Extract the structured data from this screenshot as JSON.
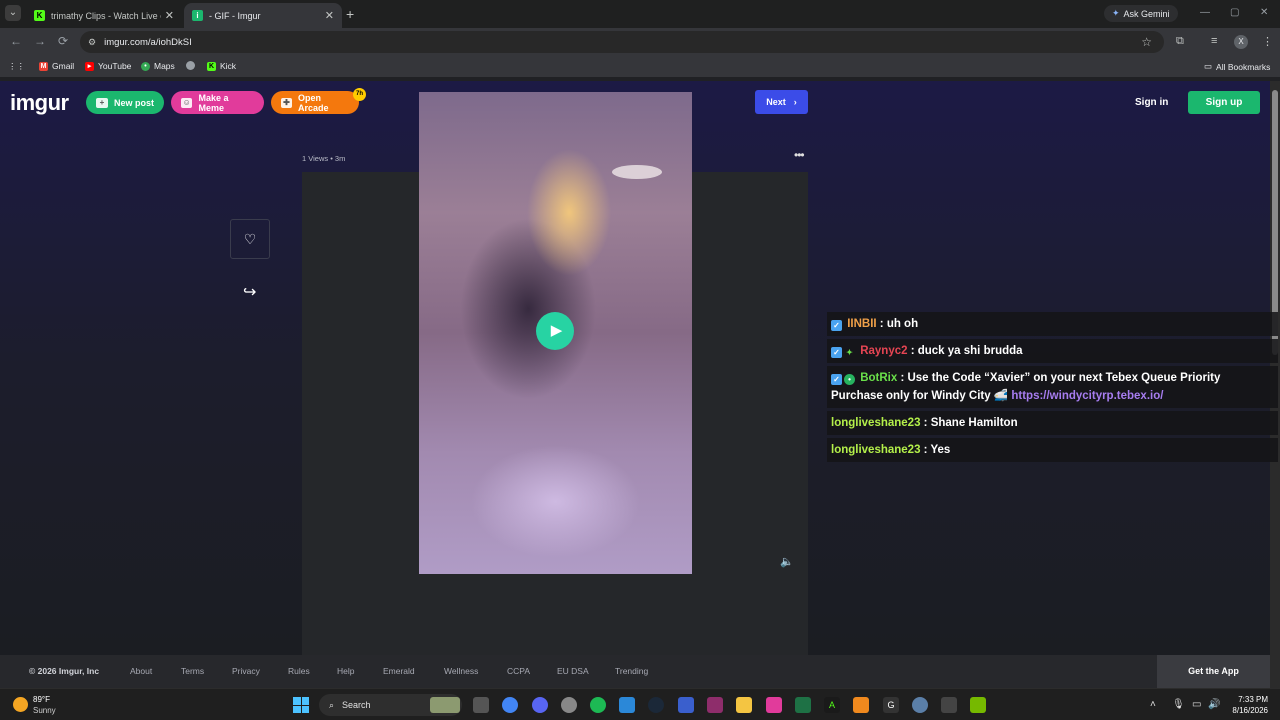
{
  "browser": {
    "tabs": [
      {
        "label": "trimathy Clips - Watch Live on Kick",
        "icon": "kick-icon"
      },
      {
        "label": "- GIF - Imgur",
        "icon": "imgur-icon"
      }
    ],
    "new_tab": "+",
    "ask_gemini": "Ask Gemini",
    "url": "imgur.com/a/iohDkSI",
    "profile_initial": "X",
    "bookmarks": [
      {
        "label": "Gmail",
        "icon": "gmail-icon"
      },
      {
        "label": "YouTube",
        "icon": "youtube-icon"
      },
      {
        "label": "Maps",
        "icon": "maps-icon"
      },
      {
        "label": "",
        "icon": "globe-icon"
      },
      {
        "label": "Kick",
        "icon": "kick-icon"
      }
    ],
    "all_bookmarks": "All Bookmarks"
  },
  "imgur": {
    "logo": "imgur",
    "new_post": "New post",
    "make_meme": "Make a Meme",
    "open_arcade": "Open Arcade",
    "arcade_badge": "7h",
    "next": "Next",
    "sign_in": "Sign in",
    "sign_up": "Sign up",
    "post_meta": "1 Views • 3m",
    "more": "•••"
  },
  "chat": [
    {
      "user": "IINBII",
      "message": " : uh oh",
      "badges": [
        "verified-icon"
      ]
    },
    {
      "user": "Raynyc2",
      "message": " : duck ya shi brudda",
      "badges": [
        "verified-icon",
        "sparkle-icon"
      ]
    },
    {
      "user": "BotRix",
      "message": " : Use the Code “Xavier” on your next Tebex Queue Priority Purchase only for Windy City 🚅 ",
      "link": "https://windycityrp.tebex.io/",
      "badges": [
        "verified-icon",
        "bot-icon"
      ]
    },
    {
      "user": "longliveshane23",
      "message": " : Shane Hamilton",
      "badges": []
    },
    {
      "user": "longliveshane23",
      "message": " : Yes",
      "badges": []
    }
  ],
  "footer": {
    "copyright": "© 2026 Imgur, Inc",
    "links": [
      "About",
      "Terms",
      "Privacy",
      "Rules",
      "Help",
      "Emerald",
      "Wellness",
      "CCPA",
      "EU DSA",
      "Trending"
    ],
    "get_app": "Get the App"
  },
  "taskbar": {
    "weather_temp": "89°F",
    "weather_cond": "Sunny",
    "search_placeholder": "Search",
    "time": "7:33 PM",
    "date": "8/16/2026",
    "discord_badge": "99+"
  },
  "colors": {
    "imgur_green": "#1bb76e",
    "meme_pink": "#e13b9b",
    "arcade_orange": "#f4780d",
    "next_blue": "#3b4ce8",
    "play_teal": "#27d3a3"
  }
}
